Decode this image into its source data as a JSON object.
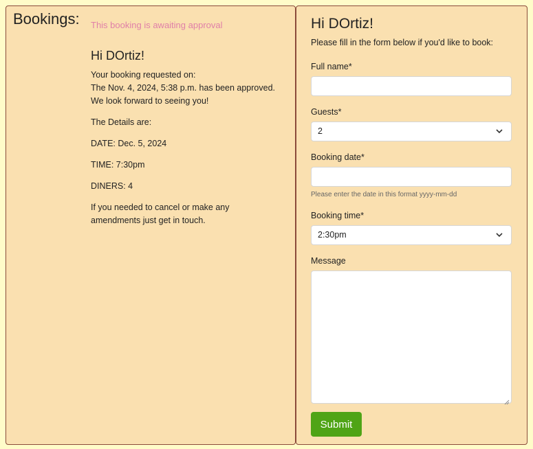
{
  "bookings": {
    "heading": "Bookings:",
    "status": "This booking is awaiting approval",
    "greeting": "Hi DOrtiz!",
    "requested_line": "Your booking requested on:",
    "approved_line": "The Nov. 4, 2024, 5:38 p.m. has been approved.",
    "forward_line": "We look forward to seeing you!",
    "details_intro": "The Details are:",
    "date": "DATE: Dec. 5, 2024",
    "time": "TIME: 7:30pm",
    "diners": "DINERS: 4",
    "cancel_line1": "If you needed to cancel or make any",
    "cancel_line2": "amendments just get in touch."
  },
  "form": {
    "title": "Hi DOrtiz!",
    "intro": "Please fill in the form below if you'd like to book:",
    "full_name_label": "Full name*",
    "full_name_value": "",
    "guests_label": "Guests*",
    "guests_value": "2",
    "booking_date_label": "Booking date*",
    "booking_date_value": "",
    "booking_date_help": "Please enter the date in this format yyyy-mm-dd",
    "booking_time_label": "Booking time*",
    "booking_time_value": "2:30pm",
    "message_label": "Message",
    "message_value": "",
    "submit_label": "Submit"
  },
  "colors": {
    "page_bg": "#fffcc9",
    "panel_bg": "#fae0b0",
    "panel_border": "#8a4a3a",
    "status_pink": "#e07fa8",
    "submit_green": "#4fa416"
  },
  "icons": {
    "select_chevron": "chevron-down-icon",
    "textarea_resize": "resize-handle-icon"
  }
}
